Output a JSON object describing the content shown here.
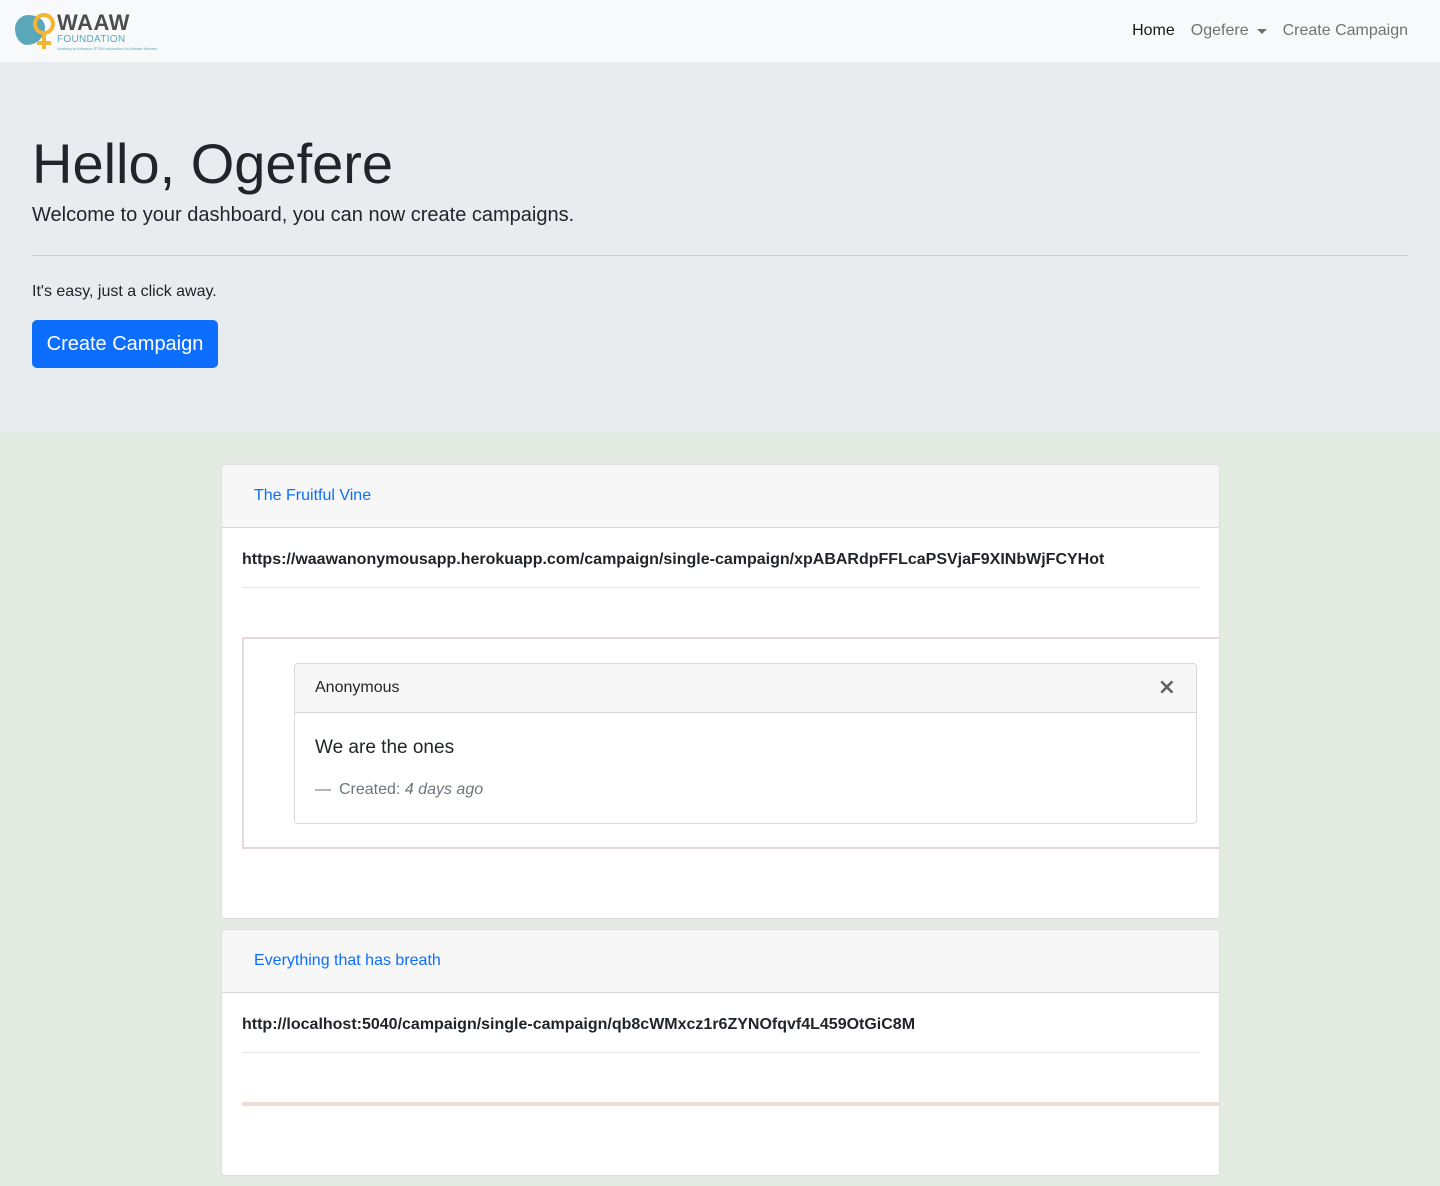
{
  "brand": {
    "name": "WAAW",
    "sub": "FOUNDATION",
    "tagline": "Working to Advance STEM education for African Women"
  },
  "nav": {
    "items": [
      {
        "label": "Home",
        "active": true
      },
      {
        "label": "Ogefere",
        "dropdown": true
      },
      {
        "label": "Create Campaign"
      }
    ]
  },
  "hero": {
    "title": "Hello, Ogefere",
    "lead": "Welcome to your dashboard, you can now create campaigns.",
    "note": "It's easy, just a click away.",
    "button_label": "Create Campaign"
  },
  "campaigns": [
    {
      "title": "The Fruitful Vine",
      "url": "https://waawanonymousapp.herokuapp.com/campaign/single-campaign/xpABARdpFFLcaPSVjaF9XINbWjFCYHot",
      "messages": [
        {
          "author": "Anonymous",
          "text": "We are the ones",
          "created_label": "Created:",
          "created_value": "4 days ago",
          "close_symbol": "×"
        }
      ]
    },
    {
      "title": "Everything that has breath",
      "url": "http://localhost:5040/campaign/single-campaign/qb8cWMxcz1r6ZYNOfqvf4L459OtGiC8M",
      "messages": []
    }
  ],
  "colors": {
    "primary": "#0d6efd",
    "page_bg": "#e3ebe3",
    "jumbotron_bg": "#e9ecef",
    "navbar_bg": "#f8f9fa"
  }
}
